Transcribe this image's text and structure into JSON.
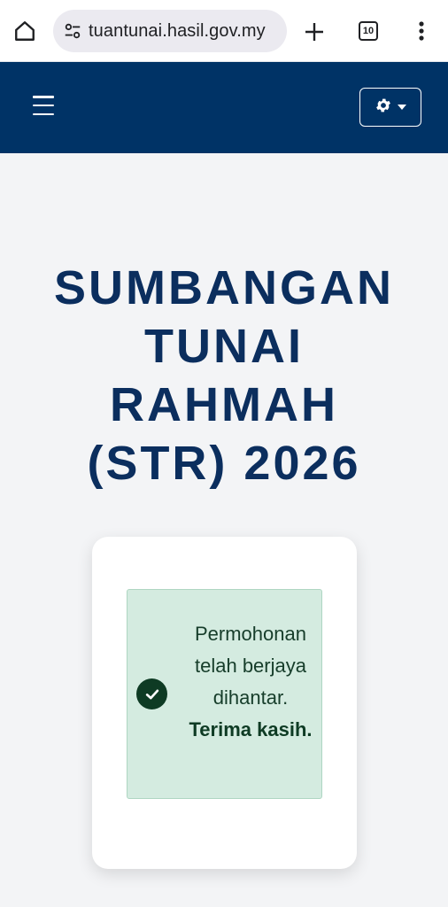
{
  "browser": {
    "url": "tuantunai.hasil.gov.my",
    "tab_count": "10"
  },
  "page": {
    "title_lines": [
      "SUMBANGAN",
      "TUNAI",
      "RAHMAH",
      "(STR) 2026"
    ]
  },
  "alert": {
    "message": "Permohonan telah berjaya dihantar.",
    "thanks": "Terima kasih."
  },
  "colors": {
    "navbar": "#003366",
    "title": "#0b2e5e",
    "alert_bg": "#d4ebe0",
    "alert_text": "#163d2a"
  }
}
